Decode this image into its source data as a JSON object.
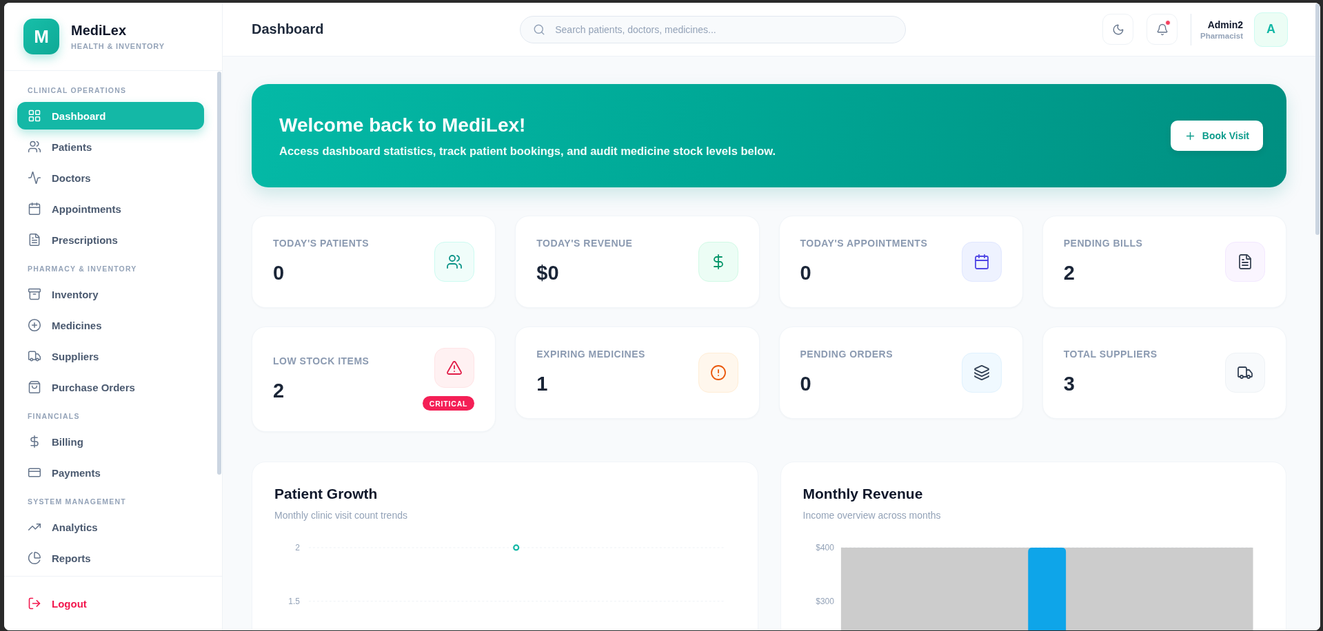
{
  "app": {
    "logo_letter": "M",
    "name": "MediLex",
    "tagline": "HEALTH & INVENTORY"
  },
  "sidebar": {
    "sections": [
      {
        "title": "CLINICAL OPERATIONS",
        "items": [
          {
            "label": "Dashboard",
            "kind": "grid",
            "selected": true
          },
          {
            "label": "Patients",
            "kind": "users",
            "selected": false
          },
          {
            "label": "Doctors",
            "kind": "pulse",
            "selected": false
          },
          {
            "label": "Appointments",
            "kind": "calendar",
            "selected": false
          },
          {
            "label": "Prescriptions",
            "kind": "document",
            "selected": false
          }
        ]
      },
      {
        "title": "PHARMACY & INVENTORY",
        "items": [
          {
            "label": "Inventory",
            "kind": "archive",
            "selected": false
          },
          {
            "label": "Medicines",
            "kind": "plus",
            "selected": false
          },
          {
            "label": "Suppliers",
            "kind": "truck",
            "selected": false
          },
          {
            "label": "Purchase Orders",
            "kind": "bag",
            "selected": false
          }
        ]
      },
      {
        "title": "FINANCIALS",
        "items": [
          {
            "label": "Billing",
            "kind": "dollar",
            "selected": false
          },
          {
            "label": "Payments",
            "kind": "card",
            "selected": false
          }
        ]
      },
      {
        "title": "SYSTEM MANAGEMENT",
        "items": [
          {
            "label": "Analytics",
            "kind": "trend",
            "selected": false
          },
          {
            "label": "Reports",
            "kind": "pie",
            "selected": false
          }
        ]
      }
    ],
    "logout": {
      "label": "Logout"
    }
  },
  "header": {
    "title": "Dashboard",
    "search": {
      "placeholder": "Search patients, doctors, medicines..."
    },
    "notifications": {
      "unread": true
    },
    "user": {
      "name": "Admin2",
      "role": "Pharmacist",
      "avatar_letter": "A"
    }
  },
  "banner": {
    "title": "Welcome back to MediLex!",
    "subtitle": "Access dashboard statistics, track patient bookings, and audit medicine stock levels below.",
    "button": "Book Visit"
  },
  "stats": [
    {
      "label": "TODAY'S PATIENTS",
      "value": "0",
      "kind": "users"
    },
    {
      "label": "TODAY'S REVENUE",
      "value": "$0",
      "kind": "dollar"
    },
    {
      "label": "TODAY'S APPOINTMENTS",
      "value": "0",
      "kind": "calendar"
    },
    {
      "label": "PENDING BILLS",
      "value": "2",
      "kind": "document"
    },
    {
      "label": "LOW STOCK ITEMS",
      "value": "2",
      "kind": "warning",
      "badge": "CRITICAL"
    },
    {
      "label": "EXPIRING MEDICINES",
      "value": "1",
      "kind": "alert"
    },
    {
      "label": "PENDING ORDERS",
      "value": "0",
      "kind": "layers"
    },
    {
      "label": "TOTAL SUPPLIERS",
      "value": "3",
      "kind": "truck"
    }
  ],
  "charts": [
    {
      "title": "Patient Growth",
      "subtitle": "Monthly clinic visit count trends",
      "chart_data": {
        "type": "line",
        "values": [
          2
        ],
        "ylim": [
          1.5,
          2
        ],
        "yticks": [
          2,
          1.5
        ],
        "marker": "circle"
      }
    },
    {
      "title": "Monthly Revenue",
      "subtitle": "Income overview across months",
      "chart_data": {
        "type": "bar",
        "values": [
          400
        ],
        "ylim": [
          0,
          400
        ],
        "yticks": [
          {
            "value": 400,
            "label": "$400"
          },
          {
            "value": 300,
            "label": "$300"
          }
        ]
      }
    }
  ]
}
